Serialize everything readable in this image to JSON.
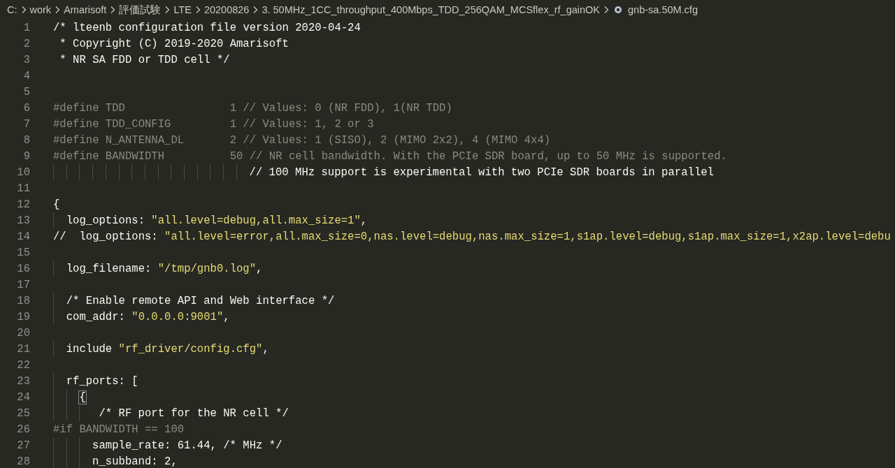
{
  "breadcrumb": [
    {
      "label": "C:",
      "kind": "folder"
    },
    {
      "label": "work",
      "kind": "folder"
    },
    {
      "label": "Amarisoft",
      "kind": "folder"
    },
    {
      "label": "評価試験",
      "kind": "folder"
    },
    {
      "label": "LTE",
      "kind": "folder"
    },
    {
      "label": "20200826",
      "kind": "folder"
    },
    {
      "label": "3. 50MHz_1CC_throughput_400Mbps_TDD_256QAM_MCSflex_rf_gainOK",
      "kind": "folder"
    },
    {
      "label": "gnb-sa.50M.cfg",
      "kind": "file"
    }
  ],
  "editor": {
    "lines": [
      {
        "number": "1",
        "tokens": [
          {
            "text": "/* lteenb configuration file version 2020-04-24",
            "kind": "text"
          }
        ]
      },
      {
        "number": "2",
        "tokens": [
          {
            "text": " * Copyright (C) 2019-2020 Amarisoft",
            "kind": "text"
          }
        ]
      },
      {
        "number": "3",
        "tokens": [
          {
            "text": " * NR SA FDD or TDD cell */",
            "kind": "text"
          }
        ]
      },
      {
        "number": "4"
      },
      {
        "number": "5"
      },
      {
        "number": "6",
        "tokens": [
          {
            "text": "#define TDD                1 // Values: 0 (NR FDD), 1(NR TDD)",
            "kind": "dim"
          }
        ]
      },
      {
        "number": "7",
        "tokens": [
          {
            "text": "#define TDD_CONFIG         1 // Values: 1, 2 or 3",
            "kind": "dim"
          }
        ]
      },
      {
        "number": "8",
        "tokens": [
          {
            "text": "#define N_ANTENNA_DL       2 // Values: 1 (SISO), 2 (MIMO 2x2), 4 (MIMO 4x4)",
            "kind": "dim"
          }
        ]
      },
      {
        "number": "9",
        "tokens": [
          {
            "text": "#define BANDWIDTH          50 // NR cell bandwidth. With the PCIe SDR board, up to 50 MHz is supported.",
            "kind": "dim"
          }
        ]
      },
      {
        "number": "10",
        "tokens": [
          {
            "text": "                              // 100 MHz support is experimental with two PCIe SDR boards in parallel",
            "kind": "text"
          }
        ]
      },
      {
        "number": "11"
      },
      {
        "number": "12",
        "tokens": [
          {
            "text": "{",
            "kind": "text"
          }
        ]
      },
      {
        "number": "13",
        "tokens": [
          {
            "text": "  log_options: ",
            "kind": "text"
          },
          {
            "text": "\"all.level=debug,all.max_size=1\"",
            "kind": "string"
          },
          {
            "text": ",",
            "kind": "text"
          }
        ]
      },
      {
        "number": "14",
        "tokens": [
          {
            "text": "//  log_options: ",
            "kind": "text"
          },
          {
            "text": "\"all.level=error,all.max_size=0,nas.level=debug,nas.max_size=1,s1ap.level=debug,s1ap.max_size=1,x2ap.level=debu",
            "kind": "string"
          }
        ]
      },
      {
        "number": "15"
      },
      {
        "number": "16",
        "tokens": [
          {
            "text": "  log_filename: ",
            "kind": "text"
          },
          {
            "text": "\"/tmp/gnb0.log\"",
            "kind": "string"
          },
          {
            "text": ",",
            "kind": "text"
          }
        ]
      },
      {
        "number": "17"
      },
      {
        "number": "18",
        "tokens": [
          {
            "text": "  /* Enable remote API and Web interface */",
            "kind": "text"
          }
        ]
      },
      {
        "number": "19",
        "tokens": [
          {
            "text": "  com_addr: ",
            "kind": "text"
          },
          {
            "text": "\"0.0.0.0:9001\"",
            "kind": "string"
          },
          {
            "text": ",",
            "kind": "text"
          }
        ]
      },
      {
        "number": "20"
      },
      {
        "number": "21",
        "tokens": [
          {
            "text": "  include ",
            "kind": "text"
          },
          {
            "text": "\"rf_driver/config.cfg\"",
            "kind": "string"
          },
          {
            "text": ",",
            "kind": "text"
          }
        ]
      },
      {
        "number": "22"
      },
      {
        "number": "23",
        "tokens": [
          {
            "text": "  rf_ports: [",
            "kind": "text"
          }
        ]
      },
      {
        "number": "24",
        "tokens": [
          {
            "text": "    {",
            "kind": "match"
          }
        ]
      },
      {
        "number": "25",
        "tokens": [
          {
            "text": "       /* RF port for the NR cell */",
            "kind": "text"
          }
        ]
      },
      {
        "number": "26",
        "tokens": [
          {
            "text": "#if BANDWIDTH == 100",
            "kind": "dim"
          }
        ]
      },
      {
        "number": "27",
        "tokens": [
          {
            "text": "      sample_rate: 61.44, /* MHz */",
            "kind": "text"
          }
        ]
      },
      {
        "number": "28",
        "tokens": [
          {
            "text": "      n_subband: 2,",
            "kind": "text"
          }
        ]
      }
    ]
  }
}
